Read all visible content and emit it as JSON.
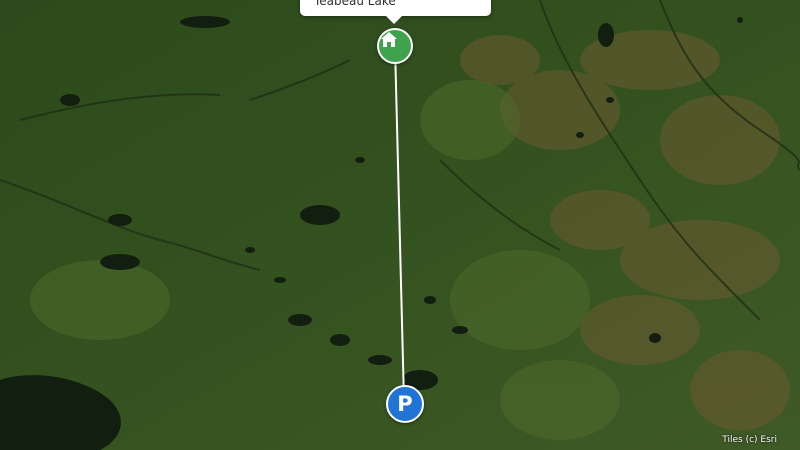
{
  "map": {
    "basemap": "satellite",
    "attribution": "Tiles (c) Esri"
  },
  "route": {
    "color": "#ffffff"
  },
  "markers": {
    "home": {
      "icon": "home-icon",
      "color": "#3fa34d"
    },
    "parking": {
      "letter": "P",
      "color": "#1f74d6"
    }
  },
  "popup": {
    "title": "Teabeau Lake"
  }
}
